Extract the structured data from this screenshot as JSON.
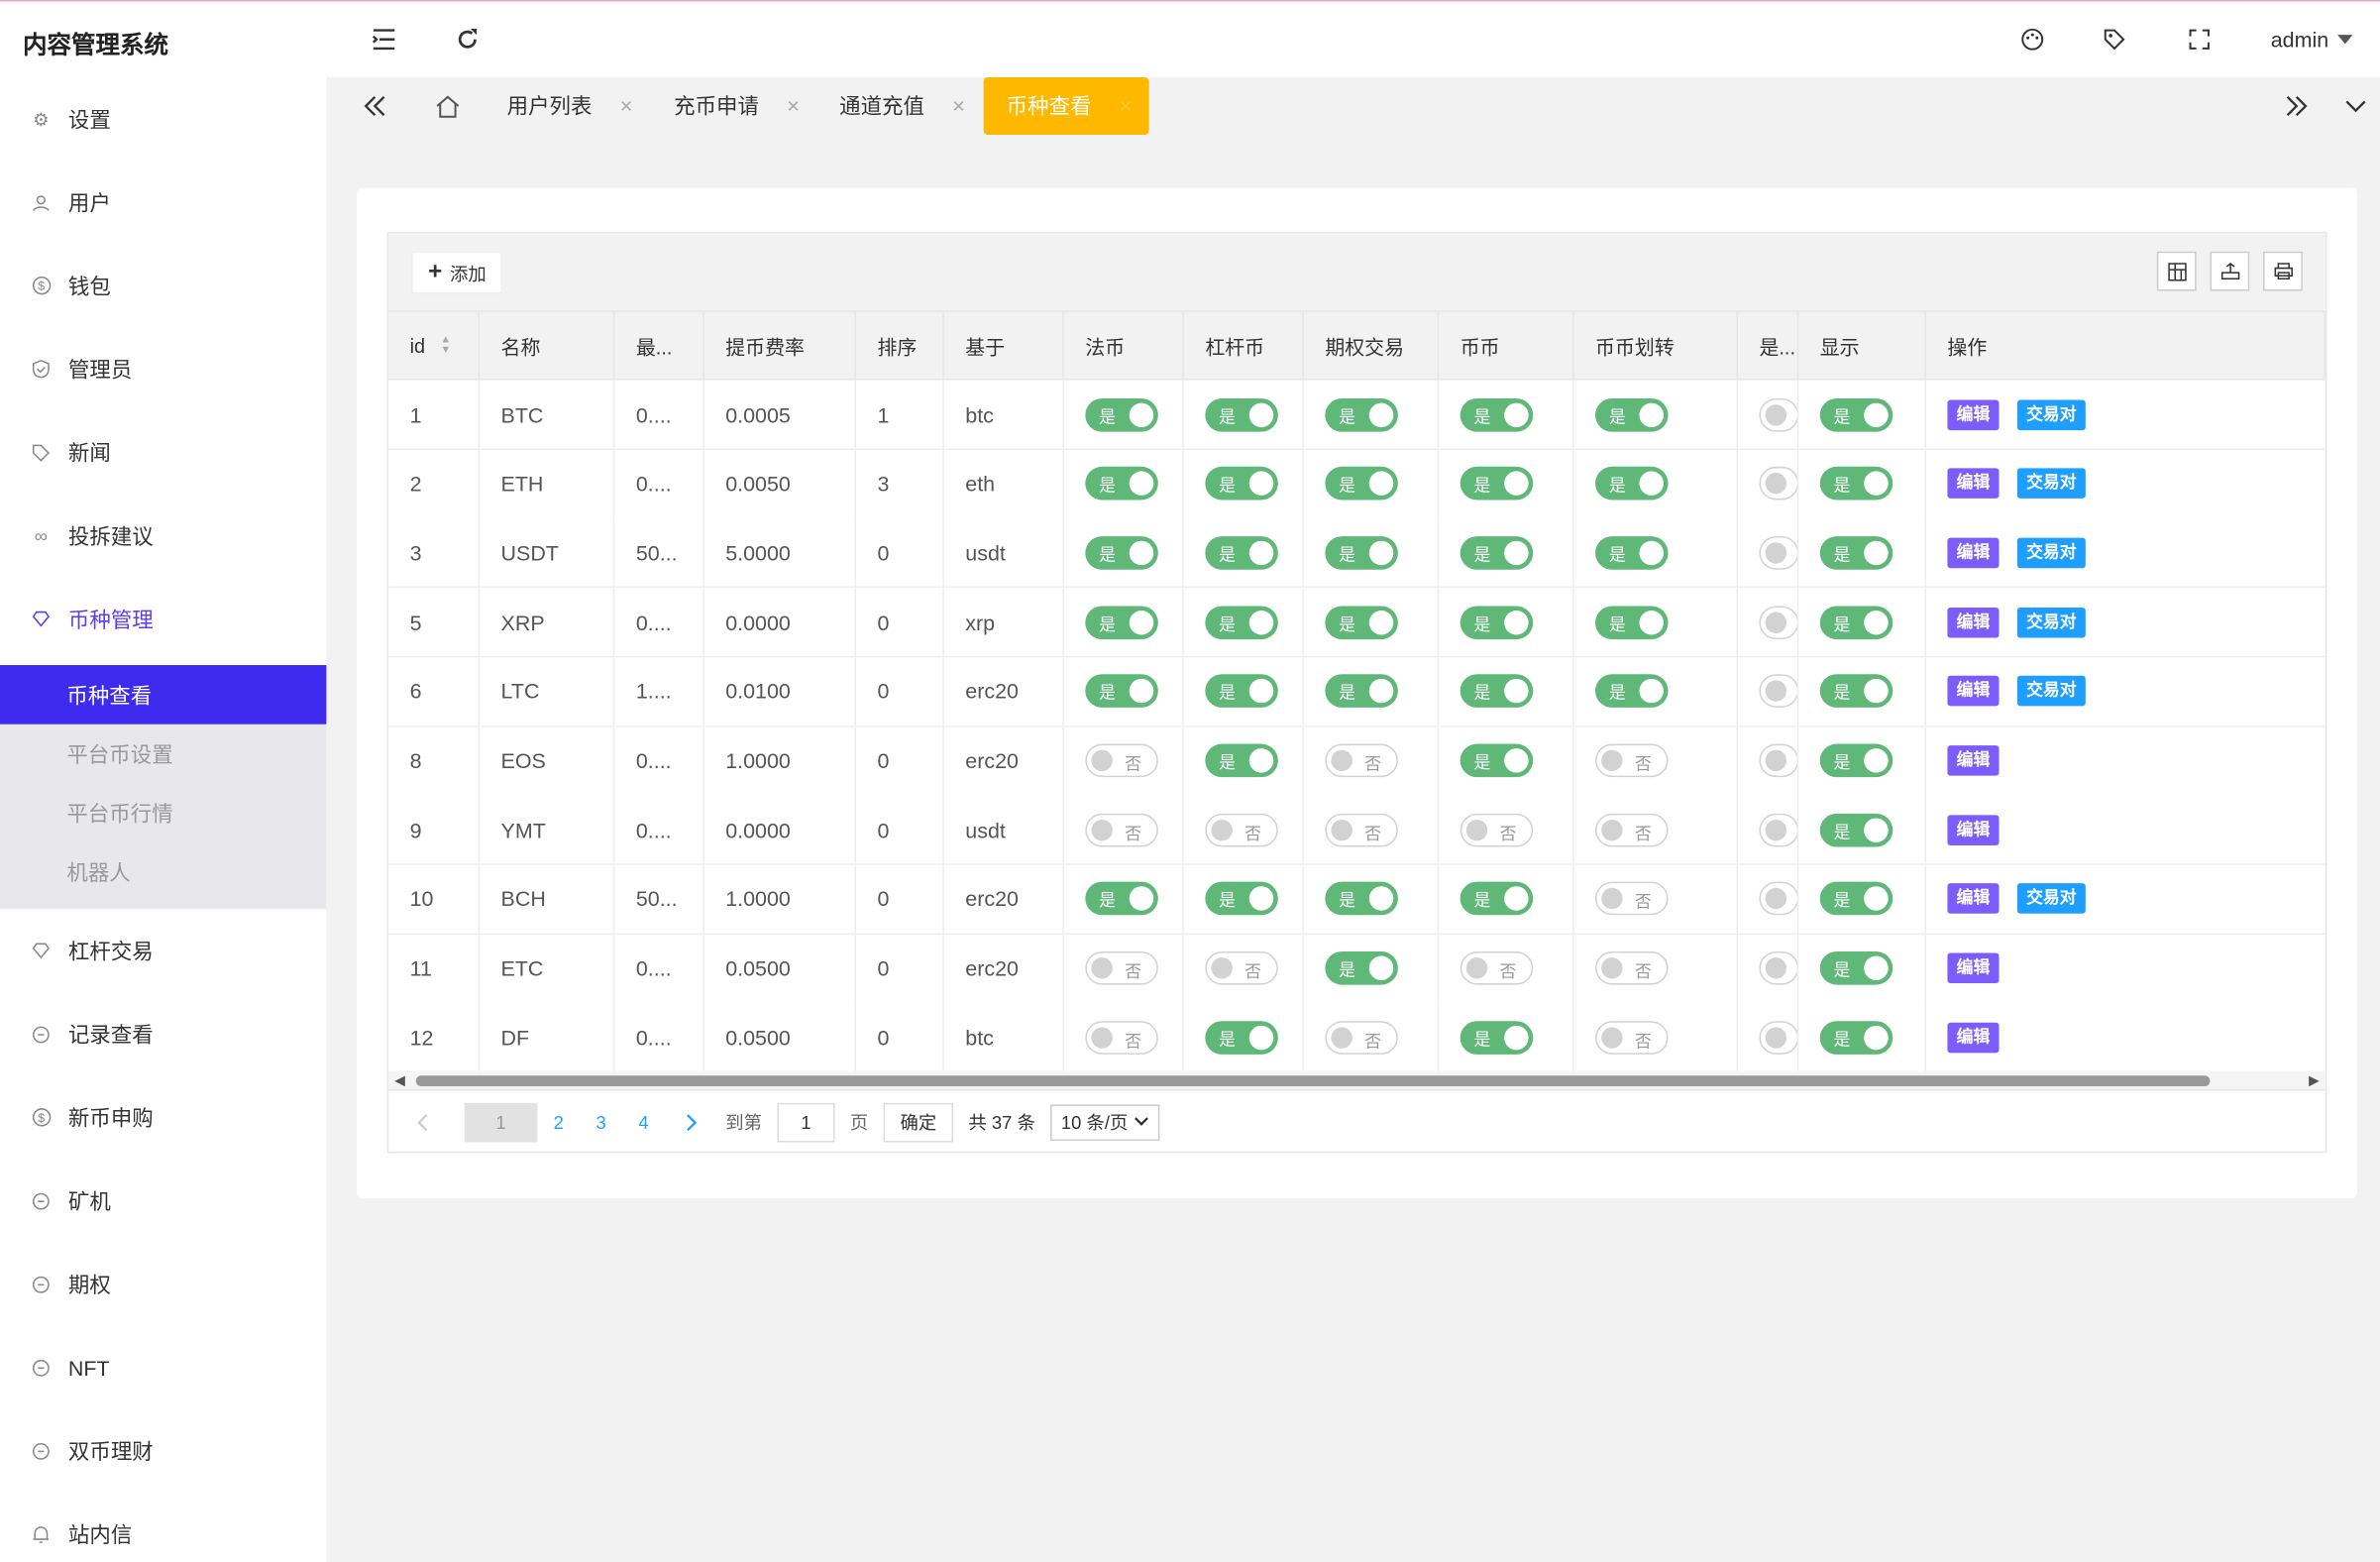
{
  "app": {
    "title": "内容管理系统",
    "user": "admin"
  },
  "header_icons": [
    "menu-icon",
    "refresh-icon",
    "theme-icon",
    "tag-icon",
    "fullscreen-icon"
  ],
  "sidebar": {
    "items": [
      {
        "label": "设置",
        "icon": "gear-icon"
      },
      {
        "label": "用户",
        "icon": "user-icon"
      },
      {
        "label": "钱包",
        "icon": "dollar-icon"
      },
      {
        "label": "管理员",
        "icon": "shield-icon"
      },
      {
        "label": "新闻",
        "icon": "tag-icon"
      },
      {
        "label": "投拆建议",
        "icon": "link-icon"
      },
      {
        "label": "币种管理",
        "icon": "diamond-icon"
      },
      {
        "label": "杠杆交易",
        "icon": "diamond-icon"
      },
      {
        "label": "记录查看",
        "icon": "circle-icon"
      },
      {
        "label": "新币申购",
        "icon": "dollar-icon"
      },
      {
        "label": "矿机",
        "icon": "circle-icon"
      },
      {
        "label": "期权",
        "icon": "circle-icon"
      },
      {
        "label": "NFT",
        "icon": "circle-icon"
      },
      {
        "label": "双币理财",
        "icon": "circle-icon"
      },
      {
        "label": "站内信",
        "icon": "bell-icon"
      }
    ],
    "sub_items": [
      {
        "label": "币种查看",
        "active": true
      },
      {
        "label": "平台币设置",
        "active": false
      },
      {
        "label": "平台币行情",
        "active": false
      },
      {
        "label": "机器人",
        "active": false
      }
    ]
  },
  "tabs": [
    {
      "label": "用户列表"
    },
    {
      "label": "充币申请"
    },
    {
      "label": "通道充值"
    },
    {
      "label": "币种查看",
      "active": true
    }
  ],
  "toolbar": {
    "add_label": "添加"
  },
  "table": {
    "columns": [
      "id",
      "名称",
      "最...",
      "提币费率",
      "排序",
      "基于",
      "法币",
      "杠杆币",
      "期权交易",
      "币币",
      "币币划转",
      "是...",
      "显示",
      "操作"
    ],
    "switch_on": "是",
    "switch_off": "否",
    "edit_label": "编辑",
    "pair_label": "交易对",
    "rows": [
      {
        "id": "1",
        "name": "BTC",
        "min": "0....",
        "fee": "0.0005",
        "sort": "1",
        "base": "btc",
        "fiat": true,
        "lever": true,
        "option": true,
        "coin": true,
        "transfer": true,
        "show": true,
        "pair": true
      },
      {
        "id": "2",
        "name": "ETH",
        "min": "0....",
        "fee": "0.0050",
        "sort": "3",
        "base": "eth",
        "fiat": true,
        "lever": true,
        "option": true,
        "coin": true,
        "transfer": true,
        "show": true,
        "pair": true
      },
      {
        "id": "3",
        "name": "USDT",
        "min": "50...",
        "fee": "5.0000",
        "sort": "0",
        "base": "usdt",
        "fiat": true,
        "lever": true,
        "option": true,
        "coin": true,
        "transfer": true,
        "show": true,
        "pair": true
      },
      {
        "id": "5",
        "name": "XRP",
        "min": "0....",
        "fee": "0.0000",
        "sort": "0",
        "base": "xrp",
        "fiat": true,
        "lever": true,
        "option": true,
        "coin": true,
        "transfer": true,
        "show": true,
        "pair": true
      },
      {
        "id": "6",
        "name": "LTC",
        "min": "1....",
        "fee": "0.0100",
        "sort": "0",
        "base": "erc20",
        "fiat": true,
        "lever": true,
        "option": true,
        "coin": true,
        "transfer": true,
        "show": true,
        "pair": true
      },
      {
        "id": "8",
        "name": "EOS",
        "min": "0....",
        "fee": "1.0000",
        "sort": "0",
        "base": "erc20",
        "fiat": false,
        "lever": true,
        "option": false,
        "coin": true,
        "transfer": false,
        "show": true,
        "pair": false
      },
      {
        "id": "9",
        "name": "YMT",
        "min": "0....",
        "fee": "0.0000",
        "sort": "0",
        "base": "usdt",
        "fiat": false,
        "lever": false,
        "option": false,
        "coin": false,
        "transfer": false,
        "show": true,
        "pair": false
      },
      {
        "id": "10",
        "name": "BCH",
        "min": "50...",
        "fee": "1.0000",
        "sort": "0",
        "base": "erc20",
        "fiat": true,
        "lever": true,
        "option": true,
        "coin": true,
        "transfer": false,
        "show": true,
        "pair": true
      },
      {
        "id": "11",
        "name": "ETC",
        "min": "0....",
        "fee": "0.0500",
        "sort": "0",
        "base": "erc20",
        "fiat": false,
        "lever": false,
        "option": true,
        "coin": false,
        "transfer": false,
        "show": true,
        "pair": false
      },
      {
        "id": "12",
        "name": "DF",
        "min": "0....",
        "fee": "0.0500",
        "sort": "0",
        "base": "btc",
        "fiat": false,
        "lever": true,
        "option": false,
        "coin": true,
        "transfer": false,
        "show": true,
        "pair": false
      }
    ]
  },
  "pagination": {
    "current": "1",
    "pages": [
      "2",
      "3",
      "4"
    ],
    "goto_label": "到第",
    "goto_value": "1",
    "page_unit": "页",
    "confirm_label": "确定",
    "total_label": "共 37 条",
    "page_size": "10 条/页"
  }
}
